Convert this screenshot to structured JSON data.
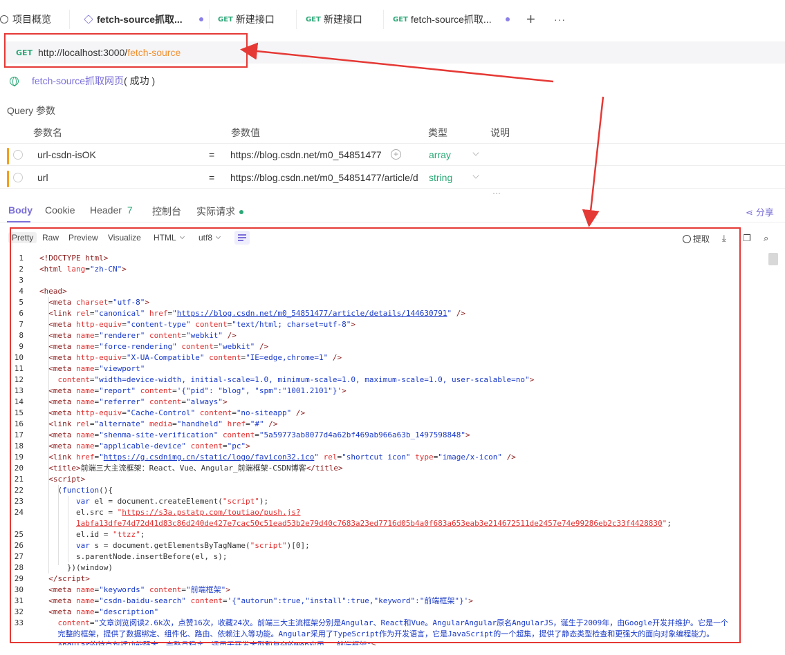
{
  "tabs": [
    {
      "label": "项目概览",
      "method": "",
      "dot": false
    },
    {
      "label": "fetch-source抓取...",
      "method": "",
      "dot": true
    },
    {
      "label": "新建接口",
      "method": "GET",
      "dot": false
    },
    {
      "label": "新建接口",
      "method": "GET",
      "dot": false
    },
    {
      "label": "fetch-source抓取...",
      "method": "GET",
      "dot": true
    }
  ],
  "tab_actions": {
    "add": "+",
    "more": "···"
  },
  "request": {
    "method": "GET",
    "url_base": "http://localhost:3000/",
    "url_path": "fetch-source",
    "api_name": "fetch-source抓取网页",
    "api_status": "( 成功 )"
  },
  "query": {
    "title": "Query 参数",
    "headers": {
      "name": "参数名",
      "value": "参数值",
      "type": "类型",
      "desc": "说明"
    },
    "rows": [
      {
        "name": "url-csdn-isOK",
        "eq": "=",
        "value": "https://blog.csdn.net/m0_54851477",
        "type": "array"
      },
      {
        "name": "url",
        "eq": "=",
        "value": "https://blog.csdn.net/m0_54851477/article/d",
        "type": "string"
      }
    ],
    "more": "···"
  },
  "response_tabs": {
    "body": "Body",
    "cookie": "Cookie",
    "header": "Header",
    "header_count": "7",
    "console": "控制台",
    "actual": "实际请求",
    "share": "分享"
  },
  "toolbar": {
    "pretty": "Pretty",
    "raw": "Raw",
    "preview": "Preview",
    "visualize": "Visualize",
    "format": "HTML",
    "encoding": "utf8",
    "extract": "提取"
  },
  "code_lines": [
    {
      "n": "1",
      "html": "<span class=\"t\">&lt;!DOCTYPE html&gt;</span>"
    },
    {
      "n": "2",
      "html": "<span class=\"t\">&lt;html</span> <span class=\"a\">lang</span>=<span class=\"s\">\"zh-CN\"</span><span class=\"t\">&gt;</span>"
    },
    {
      "n": "3",
      "html": ""
    },
    {
      "n": "4",
      "html": "<span class=\"t\">&lt;head&gt;</span>"
    },
    {
      "n": "5",
      "html": "  <span class=\"t\">&lt;meta</span> <span class=\"a\">charset</span>=<span class=\"s\">\"utf-8\"</span><span class=\"t\">&gt;</span>"
    },
    {
      "n": "6",
      "html": "  <span class=\"t\">&lt;link</span> <span class=\"a\">rel</span>=<span class=\"s\">\"canonical\"</span> <span class=\"a\">href</span>=<span class=\"s\">\"<span class=\"u\">https://blog.csdn.net/m0_54851477/article/details/144630791</span>\"</span> <span class=\"t\">/&gt;</span>"
    },
    {
      "n": "7",
      "html": "  <span class=\"t\">&lt;meta</span> <span class=\"a\">http-equiv</span>=<span class=\"s\">\"content-type\"</span> <span class=\"a\">content</span>=<span class=\"s\">\"text/html; charset=utf-8\"</span><span class=\"t\">&gt;</span>"
    },
    {
      "n": "8",
      "html": "  <span class=\"t\">&lt;meta</span> <span class=\"a\">name</span>=<span class=\"s\">\"renderer\"</span> <span class=\"a\">content</span>=<span class=\"s\">\"webkit\"</span> <span class=\"t\">/&gt;</span>"
    },
    {
      "n": "9",
      "html": "  <span class=\"t\">&lt;meta</span> <span class=\"a\">name</span>=<span class=\"s\">\"force-rendering\"</span> <span class=\"a\">content</span>=<span class=\"s\">\"webkit\"</span> <span class=\"t\">/&gt;</span>"
    },
    {
      "n": "10",
      "html": "  <span class=\"t\">&lt;meta</span> <span class=\"a\">http-equiv</span>=<span class=\"s\">\"X-UA-Compatible\"</span> <span class=\"a\">content</span>=<span class=\"s\">\"IE=edge,chrome=1\"</span> <span class=\"t\">/&gt;</span>"
    },
    {
      "n": "11",
      "html": "  <span class=\"t\">&lt;meta</span> <span class=\"a\">name</span>=<span class=\"s\">\"viewport\"</span>"
    },
    {
      "n": "12",
      "html": "    <span class=\"a\">content</span>=<span class=\"s\">\"width=device-width, initial-scale=1.0, minimum-scale=1.0, maximum-scale=1.0, user-scalable=no\"</span><span class=\"t\">&gt;</span>"
    },
    {
      "n": "13",
      "html": "  <span class=\"t\">&lt;meta</span> <span class=\"a\">name</span>=<span class=\"s\">\"report\"</span> <span class=\"a\">content</span>=<span class=\"s\">'{\"pid\": \"blog\", \"spm\":\"1001.2101\"}'</span><span class=\"t\">&gt;</span>"
    },
    {
      "n": "14",
      "html": "  <span class=\"t\">&lt;meta</span> <span class=\"a\">name</span>=<span class=\"s\">\"referrer\"</span> <span class=\"a\">content</span>=<span class=\"s\">\"always\"</span><span class=\"t\">&gt;</span>"
    },
    {
      "n": "15",
      "html": "  <span class=\"t\">&lt;meta</span> <span class=\"a\">http-equiv</span>=<span class=\"s\">\"Cache-Control\"</span> <span class=\"a\">content</span>=<span class=\"s\">\"no-siteapp\"</span> <span class=\"t\">/&gt;</span>"
    },
    {
      "n": "16",
      "html": "  <span class=\"t\">&lt;link</span> <span class=\"a\">rel</span>=<span class=\"s\">\"alternate\"</span> <span class=\"a\">media</span>=<span class=\"s\">\"handheld\"</span> <span class=\"a\">href</span>=<span class=\"s\">\"#\"</span> <span class=\"t\">/&gt;</span>"
    },
    {
      "n": "17",
      "html": "  <span class=\"t\">&lt;meta</span> <span class=\"a\">name</span>=<span class=\"s\">\"shenma-site-verification\"</span> <span class=\"a\">content</span>=<span class=\"s\">\"5a59773ab8077d4a62bf469ab966a63b_1497598848\"</span><span class=\"t\">&gt;</span>"
    },
    {
      "n": "18",
      "html": "  <span class=\"t\">&lt;meta</span> <span class=\"a\">name</span>=<span class=\"s\">\"applicable-device\"</span> <span class=\"a\">content</span>=<span class=\"s\">\"pc\"</span><span class=\"t\">&gt;</span>"
    },
    {
      "n": "19",
      "html": "  <span class=\"t\">&lt;link</span> <span class=\"a\">href</span>=<span class=\"s\">\"<span class=\"u\">https://g.csdnimg.cn/static/logo/favicon32.ico</span>\"</span> <span class=\"a\">rel</span>=<span class=\"s\">\"shortcut icon\"</span> <span class=\"a\">type</span>=<span class=\"s\">\"image/x-icon\"</span> <span class=\"t\">/&gt;</span>"
    },
    {
      "n": "20",
      "html": "  <span class=\"t\">&lt;title&gt;</span>前端三大主流框架：React、Vue、Angular_前端框架-CSDN博客<span class=\"t\">&lt;/title&gt;</span>"
    },
    {
      "n": "21",
      "html": "  <span class=\"t\">&lt;script&gt;</span>"
    },
    {
      "n": "22",
      "html": "    (<span class=\"k\">function</span>(){"
    },
    {
      "n": "23",
      "html": "        <span class=\"k\">var</span> el = document.createElement(<span class=\"a\">\"script\"</span>);"
    },
    {
      "n": "24",
      "html": "        el.src = <span class=\"a\">\"<span class=\"u\">https://s3a.pstatp.com/toutiao/push.js?</span></span>"
    },
    {
      "n": "",
      "html": "        <span class=\"a\"><span class=\"u\">1abfa13dfe74d72d41d83c86d240de427e7cac50c51ead53b2e79d40c7683a23ed7716d05b4a0f683a653eab3e214672511de2457e74e99286eb2c33f4428830</span>\"</span>;"
    },
    {
      "n": "25",
      "html": "        el.id = <span class=\"a\">\"ttzz\"</span>;"
    },
    {
      "n": "26",
      "html": "        <span class=\"k\">var</span> s = document.getElementsByTagName(<span class=\"a\">\"script\"</span>)[0];"
    },
    {
      "n": "27",
      "html": "        s.parentNode.insertBefore(el, s);"
    },
    {
      "n": "28",
      "html": "      })(window)"
    },
    {
      "n": "29",
      "html": "  <span class=\"t\">&lt;/script&gt;</span>"
    },
    {
      "n": "30",
      "html": "  <span class=\"t\">&lt;meta</span> <span class=\"a\">name</span>=<span class=\"s\">\"keywords\"</span> <span class=\"a\">content</span>=<span class=\"s\">\"前端框架\"</span><span class=\"t\">&gt;</span>"
    },
    {
      "n": "31",
      "html": "  <span class=\"t\">&lt;meta</span> <span class=\"a\">name</span>=<span class=\"s\">\"csdn-baidu-search\"</span> <span class=\"a\">content</span>=<span class=\"s\">'{\"autorun\":true,\"install\":true,\"keyword\":\"前端框架\"}'</span><span class=\"t\">&gt;</span>"
    },
    {
      "n": "32",
      "html": "  <span class=\"t\">&lt;meta</span> <span class=\"a\">name</span>=<span class=\"s\">\"description\"</span>"
    },
    {
      "n": "33",
      "html": "    <span class=\"a\">content</span>=<span class=\"s\">\"文章浏览阅读2.6k次，点赞16次，收藏24次。前端三大主流框架分别是Angular、React和Vue。AngularAngular原名AngularJS，诞生于2009年，由Google开发并维护。它是一个</span>"
    },
    {
      "n": "",
      "html": "    <span class=\"s\">完整的框架，提供了数据绑定、组件化、路由、依赖注入等功能。Angular采用了TypeScript作为开发语言，它是JavaScript的一个超集，提供了静态类型检查和更强大的面向对象编程能力。</span>"
    },
    {
      "n": "",
      "html": "    <span class=\"s\">Angular的特点包括功能强大、完整且稳定，适用于开发大型和复杂的Web应用。_前端框架\"</span><span class=\"t\">&gt;</span>"
    }
  ]
}
